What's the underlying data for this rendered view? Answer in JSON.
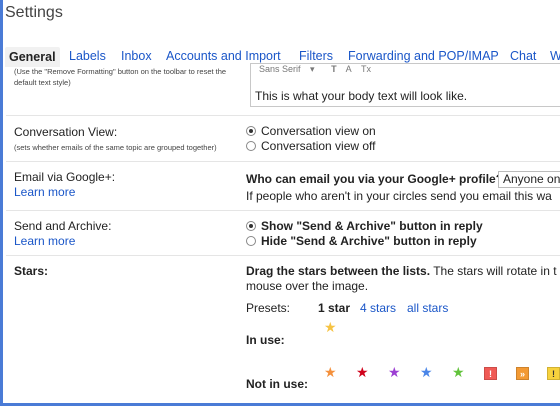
{
  "title": "Settings",
  "tabs": [
    {
      "label": "General",
      "active": true
    },
    {
      "label": "Labels"
    },
    {
      "label": "Inbox"
    },
    {
      "label": "Accounts and Import"
    },
    {
      "label": "Filters"
    },
    {
      "label": "Forwarding and POP/IMAP"
    },
    {
      "label": "Chat"
    },
    {
      "label": "W"
    }
  ],
  "default_text_style": {
    "help_line1": "(Use the \"Remove Formatting\" button on the toolbar to reset the",
    "help_line2": "default text style)",
    "toolbar_font": "Sans Serif",
    "toolbar_dropdown": "▾",
    "toolbar_size": "T",
    "toolbar_color": "A",
    "toolbar_remove": "Tx",
    "preview_text": "This is what your body text will look like."
  },
  "conversation_view": {
    "label": "Conversation View:",
    "help": "(sets whether emails of the same topic are grouped together)",
    "options": [
      {
        "label": "Conversation view on",
        "checked": true
      },
      {
        "label": "Conversation view off",
        "checked": false
      }
    ]
  },
  "email_via_google_plus": {
    "label": "Email via Google+:",
    "learn_more": "Learn more",
    "question": "Who can email you via your Google+ profile?",
    "selected": "Anyone on",
    "note": "If people who aren't in your circles send you email this wa"
  },
  "send_and_archive": {
    "label": "Send and Archive:",
    "learn_more": "Learn more",
    "options": [
      {
        "label": "Show \"Send & Archive\" button in reply",
        "checked": true
      },
      {
        "label": "Hide \"Send & Archive\" button in reply",
        "checked": false
      }
    ]
  },
  "stars": {
    "label": "Stars:",
    "instruction_bold": "Drag the stars between the lists.",
    "instruction_rest": "The stars will rotate in t",
    "instruction_line2": "mouse over the image.",
    "presets_label": "Presets:",
    "presets": [
      {
        "label": "1 star",
        "selected": true
      },
      {
        "label": "4 stars",
        "selected": false
      },
      {
        "label": "all stars",
        "selected": false
      }
    ],
    "in_use_label": "In use:",
    "not_in_use_label": "Not in use:",
    "in_use_icons": [
      {
        "name": "yellow-star-icon",
        "color": "#f6c343"
      }
    ],
    "not_in_use_icons": [
      {
        "name": "orange-star-icon",
        "color": "#f4903c",
        "kind": "star"
      },
      {
        "name": "red-star-icon",
        "color": "#d0021b",
        "kind": "star"
      },
      {
        "name": "purple-star-icon",
        "color": "#9c3fd3",
        "kind": "star"
      },
      {
        "name": "blue-star-icon",
        "color": "#4a86e8",
        "kind": "star"
      },
      {
        "name": "green-star-icon",
        "color": "#62c33c",
        "kind": "star"
      },
      {
        "name": "red-bang-icon",
        "color": "#f05a55",
        "kind": "square",
        "glyph": "!"
      },
      {
        "name": "orange-guillemet-icon",
        "color": "#f39a34",
        "kind": "square",
        "glyph": "»"
      },
      {
        "name": "yellow-bang-icon",
        "color": "#f7d23d",
        "kind": "square",
        "glyph": "!"
      }
    ]
  }
}
